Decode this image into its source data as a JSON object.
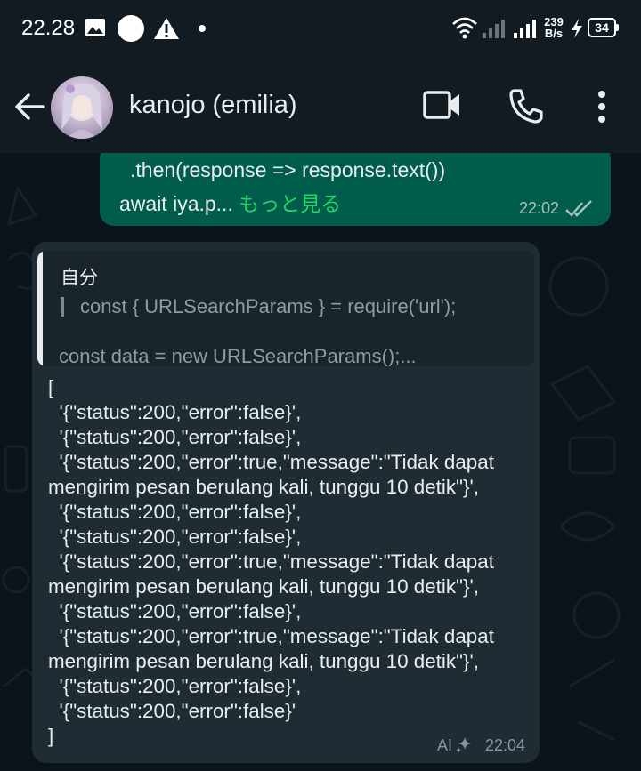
{
  "status_bar": {
    "time": "22.28",
    "net_speed_value": "239",
    "net_speed_unit": "B/s",
    "battery": "34",
    "icons": [
      "gallery-icon",
      "circle-notification-icon",
      "warning-icon",
      "dot-icon",
      "wifi-icon",
      "signal-icon",
      "signal-icon",
      "charging-icon",
      "battery-icon"
    ]
  },
  "header": {
    "contact_name": "kanojo (emilia)",
    "actions": [
      "video-call-icon",
      "voice-call-icon",
      "more-options-icon"
    ]
  },
  "messages": {
    "outgoing": {
      "line1": ".then(response => response.text())",
      "line2": "await iya.p... ",
      "read_more": "もっと見る",
      "time": "22:02",
      "status": "read"
    },
    "incoming": {
      "quote": {
        "sender": "自分",
        "line1": "const { URLSearchParams } = require('url');",
        "line2": "const data = new URLSearchParams();..."
      },
      "lines": [
        "[",
        "  '{\"status\":200,\"error\":false}',",
        "  '{\"status\":200,\"error\":false}',",
        "  '{\"status\":200,\"error\":true,\"message\":\"Tidak dapat",
        "mengirim pesan berulang kali, tunggu 10 detik\"}',",
        "  '{\"status\":200,\"error\":false}',",
        "  '{\"status\":200,\"error\":false}',",
        "  '{\"status\":200,\"error\":true,\"message\":\"Tidak dapat",
        "mengirim pesan berulang kali, tunggu 10 detik\"}',",
        "  '{\"status\":200,\"error\":false}',",
        "  '{\"status\":200,\"error\":true,\"message\":\"Tidak dapat",
        "mengirim pesan berulang kali, tunggu 10 detik\"}',",
        "  '{\"status\":200,\"error\":false}',",
        "  '{\"status\":200,\"error\":false}'",
        "]"
      ],
      "ai_label": "AI",
      "time": "22:04"
    }
  },
  "colors": {
    "background": "#0b141a",
    "header": "#121b22",
    "outgoing_bubble": "#005c4b",
    "incoming_bubble": "#202c33",
    "accent_green": "#25d366"
  }
}
